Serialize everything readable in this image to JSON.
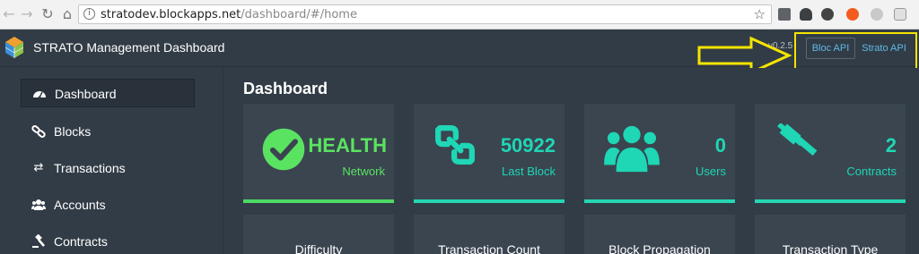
{
  "browser": {
    "url_host": "stratodev.blockapps.net",
    "url_path": "/dashboard/#/home"
  },
  "header": {
    "title": "STRATO Management Dashboard",
    "version": "v0.2.5",
    "bloc_api": "Bloc API",
    "strato_api": "Strato API"
  },
  "sidebar": {
    "items": [
      {
        "label": "Dashboard",
        "icon": "dashboard-icon"
      },
      {
        "label": "Blocks",
        "icon": "link-icon"
      },
      {
        "label": "Transactions",
        "icon": "exchange-icon"
      },
      {
        "label": "Accounts",
        "icon": "users-icon"
      },
      {
        "label": "Contracts",
        "icon": "gavel-icon"
      }
    ]
  },
  "main": {
    "title": "Dashboard",
    "cards": [
      {
        "value": "HEALTH",
        "label": "Network",
        "icon": "check-circle-icon",
        "color": "#5ae361"
      },
      {
        "value": "50922",
        "label": "Last Block",
        "icon": "chain-link-icon",
        "color": "#1fd6b5"
      },
      {
        "value": "0",
        "label": "Users",
        "icon": "users-icon",
        "color": "#1fd6b5"
      },
      {
        "value": "2",
        "label": "Contracts",
        "icon": "gavel-icon",
        "color": "#1fd6b5"
      }
    ],
    "bottom_cards": [
      {
        "title": "Difficulty"
      },
      {
        "title": "Transaction Count"
      },
      {
        "title": "Block Propagation"
      },
      {
        "title": "Transaction Type"
      }
    ]
  },
  "colors": {
    "accent": "#1fd6b5",
    "health": "#5ae361",
    "annotation": "#f5e400"
  }
}
